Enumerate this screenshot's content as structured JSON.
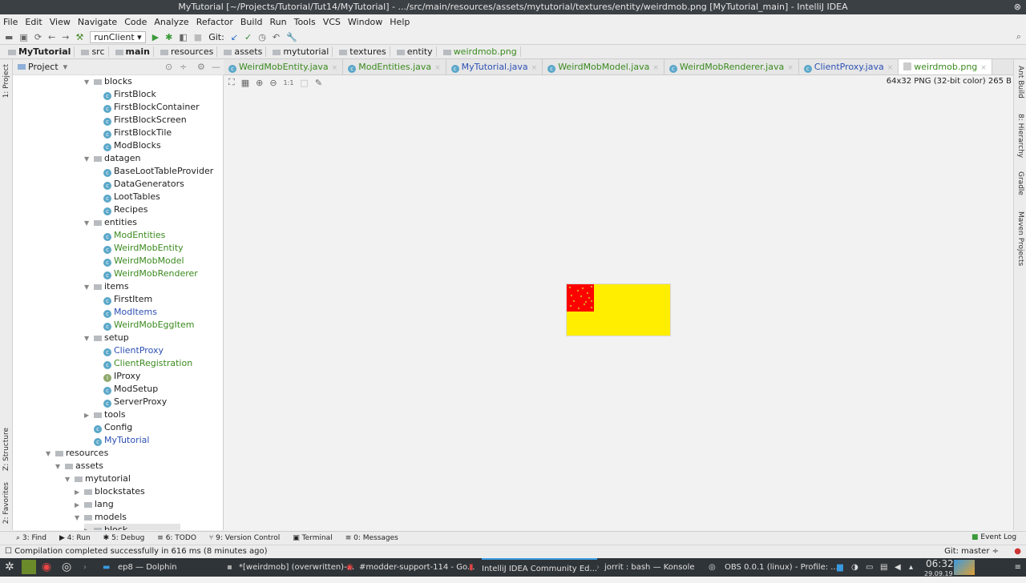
{
  "window": {
    "title": "MyTutorial [~/Projects/Tutorial/Tut14/MyTutorial] - .../src/main/resources/assets/mytutorial/textures/entity/weirdmob.png [MyTutorial_main] - IntelliJ IDEA"
  },
  "menu": [
    "File",
    "Edit",
    "View",
    "Navigate",
    "Code",
    "Analyze",
    "Refactor",
    "Build",
    "Run",
    "Tools",
    "VCS",
    "Window",
    "Help"
  ],
  "toolbar": {
    "run_config": "runClient",
    "git_label": "Git:"
  },
  "breadcrumb": [
    "MyTutorial",
    "src",
    "main",
    "resources",
    "assets",
    "mytutorial",
    "textures",
    "entity",
    "weirdmob.png"
  ],
  "project_panel": {
    "title": "Project"
  },
  "side_tools": {
    "left": [
      "1: Project",
      "Z: Structure",
      "2: Favorites"
    ],
    "right": [
      "Ant Build",
      "8: Hierarchy",
      "Gradle",
      "Maven Projects"
    ]
  },
  "tree": [
    {
      "label": "blocks",
      "lvl": 4,
      "type": "folder",
      "open": true
    },
    {
      "label": "FirstBlock",
      "lvl": 5,
      "type": "class"
    },
    {
      "label": "FirstBlockContainer",
      "lvl": 5,
      "type": "class"
    },
    {
      "label": "FirstBlockScreen",
      "lvl": 5,
      "type": "class"
    },
    {
      "label": "FirstBlockTile",
      "lvl": 5,
      "type": "class"
    },
    {
      "label": "ModBlocks",
      "lvl": 5,
      "type": "class"
    },
    {
      "label": "datagen",
      "lvl": 4,
      "type": "folder",
      "open": true
    },
    {
      "label": "BaseLootTableProvider",
      "lvl": 5,
      "type": "class"
    },
    {
      "label": "DataGenerators",
      "lvl": 5,
      "type": "class"
    },
    {
      "label": "LootTables",
      "lvl": 5,
      "type": "class"
    },
    {
      "label": "Recipes",
      "lvl": 5,
      "type": "class"
    },
    {
      "label": "entities",
      "lvl": 4,
      "type": "folder",
      "open": true
    },
    {
      "label": "ModEntities",
      "lvl": 5,
      "type": "class",
      "color": "#3a8a1e"
    },
    {
      "label": "WeirdMobEntity",
      "lvl": 5,
      "type": "class",
      "color": "#3a8a1e"
    },
    {
      "label": "WeirdMobModel",
      "lvl": 5,
      "type": "class",
      "color": "#3a8a1e"
    },
    {
      "label": "WeirdMobRenderer",
      "lvl": 5,
      "type": "class",
      "color": "#3a8a1e"
    },
    {
      "label": "items",
      "lvl": 4,
      "type": "folder",
      "open": true
    },
    {
      "label": "FirstItem",
      "lvl": 5,
      "type": "class"
    },
    {
      "label": "ModItems",
      "lvl": 5,
      "type": "class",
      "color": "#2d50b4"
    },
    {
      "label": "WeirdMobEggItem",
      "lvl": 5,
      "type": "class",
      "color": "#3a8a1e"
    },
    {
      "label": "setup",
      "lvl": 4,
      "type": "folder",
      "open": true
    },
    {
      "label": "ClientProxy",
      "lvl": 5,
      "type": "class",
      "color": "#2d50b4"
    },
    {
      "label": "ClientRegistration",
      "lvl": 5,
      "type": "class",
      "color": "#3a8a1e"
    },
    {
      "label": "IProxy",
      "lvl": 5,
      "type": "interface"
    },
    {
      "label": "ModSetup",
      "lvl": 5,
      "type": "class"
    },
    {
      "label": "ServerProxy",
      "lvl": 5,
      "type": "class"
    },
    {
      "label": "tools",
      "lvl": 4,
      "type": "folder",
      "open": false
    },
    {
      "label": "Config",
      "lvl": 4,
      "type": "class"
    },
    {
      "label": "MyTutorial",
      "lvl": 4,
      "type": "class",
      "color": "#2d50b4"
    },
    {
      "label": "resources",
      "lvl": 0,
      "type": "folder",
      "open": true
    },
    {
      "label": "assets",
      "lvl": 1,
      "type": "folder",
      "open": true
    },
    {
      "label": "mytutorial",
      "lvl": 2,
      "type": "folder",
      "open": true
    },
    {
      "label": "blockstates",
      "lvl": 3,
      "type": "folder",
      "open": false
    },
    {
      "label": "lang",
      "lvl": 3,
      "type": "folder",
      "open": false
    },
    {
      "label": "models",
      "lvl": 3,
      "type": "folder",
      "open": true
    },
    {
      "label": "block",
      "lvl": 4,
      "type": "folder",
      "open": false
    }
  ],
  "tabs": [
    {
      "label": "WeirdMobEntity.java",
      "color": "#3a8a1e"
    },
    {
      "label": "ModEntities.java",
      "color": "#3a8a1e"
    },
    {
      "label": "MyTutorial.java",
      "color": "#2d50b4"
    },
    {
      "label": "WeirdMobModel.java",
      "color": "#3a8a1e"
    },
    {
      "label": "WeirdMobRenderer.java",
      "color": "#3a8a1e"
    },
    {
      "label": "ClientProxy.java",
      "color": "#2d50b4"
    },
    {
      "label": "weirdmob.png",
      "color": "#3a8a1e",
      "active": true
    }
  ],
  "image_viewer": {
    "info": "64x32 PNG (32-bit color) 265 B",
    "zoom_actual": "1:1",
    "colors": {
      "background": "#ffee00",
      "patch": "#ff0000",
      "dots": "#e09a20"
    }
  },
  "bottom_tools": [
    "3: Find",
    "4: Run",
    "5: Debug",
    "6: TODO",
    "9: Version Control",
    "Terminal",
    "0: Messages"
  ],
  "event_log": "Event Log",
  "status": {
    "message": "Compilation completed successfully in 616 ms (8 minutes ago)",
    "git": "Git: master ÷"
  },
  "taskbar": {
    "tasks": [
      "ep8 — Dolphin",
      "*[weirdmob] (overwritten)-...",
      "#modder-support-114 - Go...",
      "IntelliJ IDEA Community Ed...",
      "jorrit : bash — Konsole",
      "OBS 0.0.1 (linux) - Profile: ..."
    ],
    "time": "06:32",
    "date": "29.09.19"
  }
}
